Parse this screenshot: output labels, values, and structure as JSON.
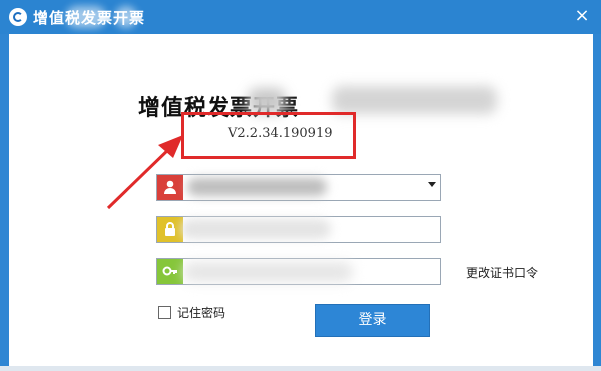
{
  "window": {
    "title": "增值税发票开票",
    "close_label": "×",
    "accent_color": "#2b84d1"
  },
  "login": {
    "heading": "增值税发票开票",
    "version": "V2.2.34.190919",
    "username_value": "",
    "password_value": "",
    "cert_password_value": "",
    "change_cert_label": "更改证书口令",
    "remember_label": "记住密码",
    "remember_checked": false,
    "login_button": "登录"
  },
  "annotation": {
    "highlight_color": "#e02a2a"
  }
}
